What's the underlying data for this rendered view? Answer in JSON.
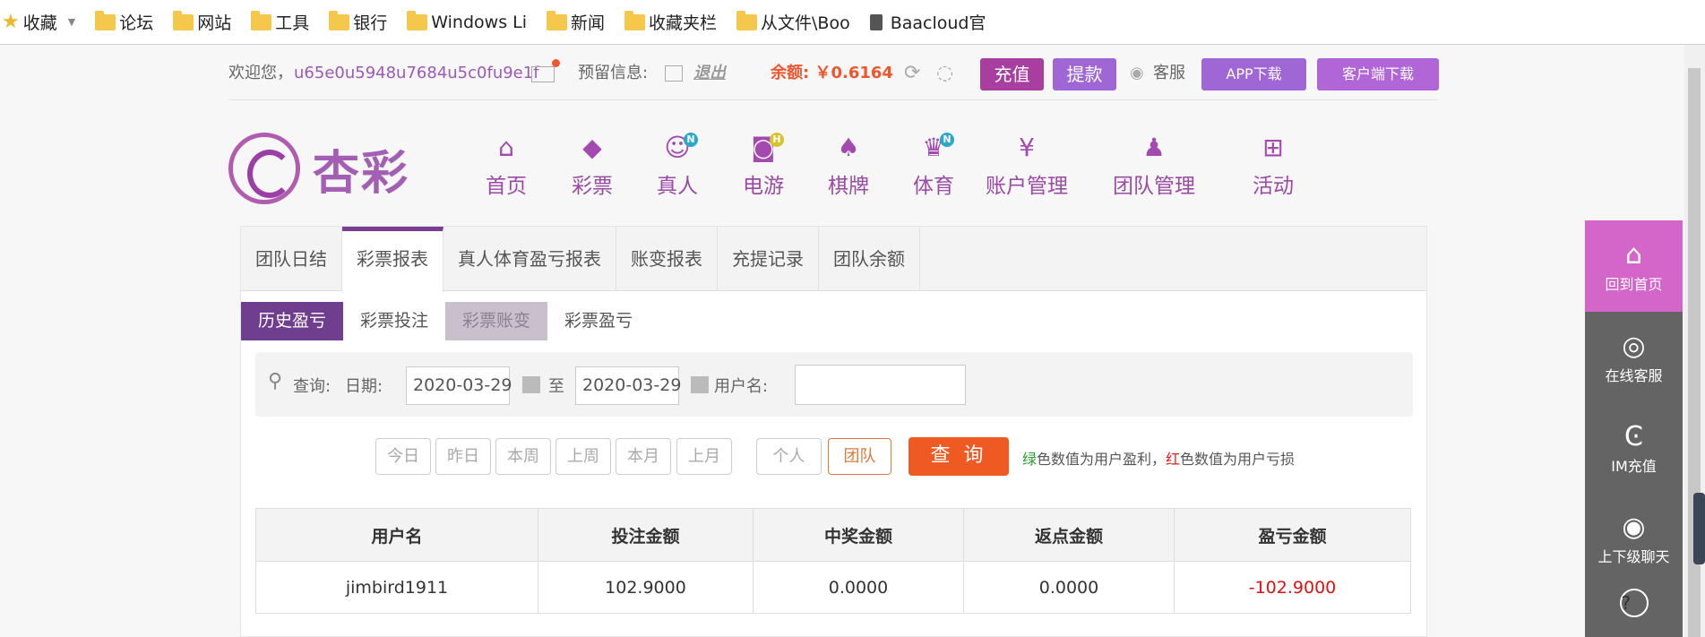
{
  "bookmarks": {
    "favorites": "收藏",
    "items": [
      "论坛",
      "网站",
      "工具",
      "银行",
      "Windows Li",
      "新闻",
      "收藏夹栏",
      "从文件\\Boo"
    ],
    "last": "Baacloud官"
  },
  "info": {
    "welcome": "欢迎您，",
    "username": "u65e0u5948u7684u5c0fu9e1f",
    "reserved": "预留信息:",
    "logout": "退出",
    "balance": "余额: ￥0.6164",
    "recharge": "充值",
    "withdraw": "提款",
    "service": "客服",
    "app_download": "APP下载",
    "client_download": "客户端下载"
  },
  "logo": {
    "text": "杏彩"
  },
  "nav": [
    {
      "label": "首页",
      "icon": "home-icon",
      "badge": ""
    },
    {
      "label": "彩票",
      "icon": "ticket-icon",
      "badge": ""
    },
    {
      "label": "真人",
      "icon": "dealer-icon",
      "badge": "N"
    },
    {
      "label": "电游",
      "icon": "gamepad-icon",
      "badge": "H"
    },
    {
      "label": "棋牌",
      "icon": "cards-icon",
      "badge": ""
    },
    {
      "label": "体育",
      "icon": "trophy-icon",
      "badge": "N"
    },
    {
      "label": "账户管理",
      "icon": "yen-icon",
      "badge": ""
    },
    {
      "label": "团队管理",
      "icon": "team-icon",
      "badge": ""
    },
    {
      "label": "活动",
      "icon": "gift-icon",
      "badge": ""
    }
  ],
  "tabs": [
    "团队日结",
    "彩票报表",
    "真人体育盈亏报表",
    "账变报表",
    "充提记录",
    "团队余额"
  ],
  "subtabs": [
    "历史盈亏",
    "彩票投注",
    "彩票账变",
    "彩票盈亏"
  ],
  "query": {
    "label": "查询:",
    "date_label": "日期:",
    "start_date": "2020-03-29",
    "to": "至",
    "end_date": "2020-03-29",
    "user_label": "用户名:",
    "user_value": ""
  },
  "quick": [
    "今日",
    "昨日",
    "本周",
    "上周",
    "本月",
    "上月"
  ],
  "scope": [
    "个人",
    "团队"
  ],
  "search_button": "查 询",
  "hint": {
    "green": "绿",
    "mid": "色数值为用户盈利，",
    "red": "红",
    "end": "色数值为用户亏损"
  },
  "table": {
    "headers": [
      "用户名",
      "投注金额",
      "中奖金额",
      "返点金额",
      "盈亏金额"
    ],
    "rows": [
      [
        "jimbird1911",
        "102.9000",
        "0.0000",
        "0.0000",
        "-102.9000"
      ]
    ]
  },
  "float": [
    "回到首页",
    "在线客服",
    "IM充值",
    "上下级聊天"
  ],
  "colors": {
    "accent": "#6f3e8e",
    "search": "#ef5a23",
    "home_float": "#d466c9",
    "negative": "#d11111"
  }
}
